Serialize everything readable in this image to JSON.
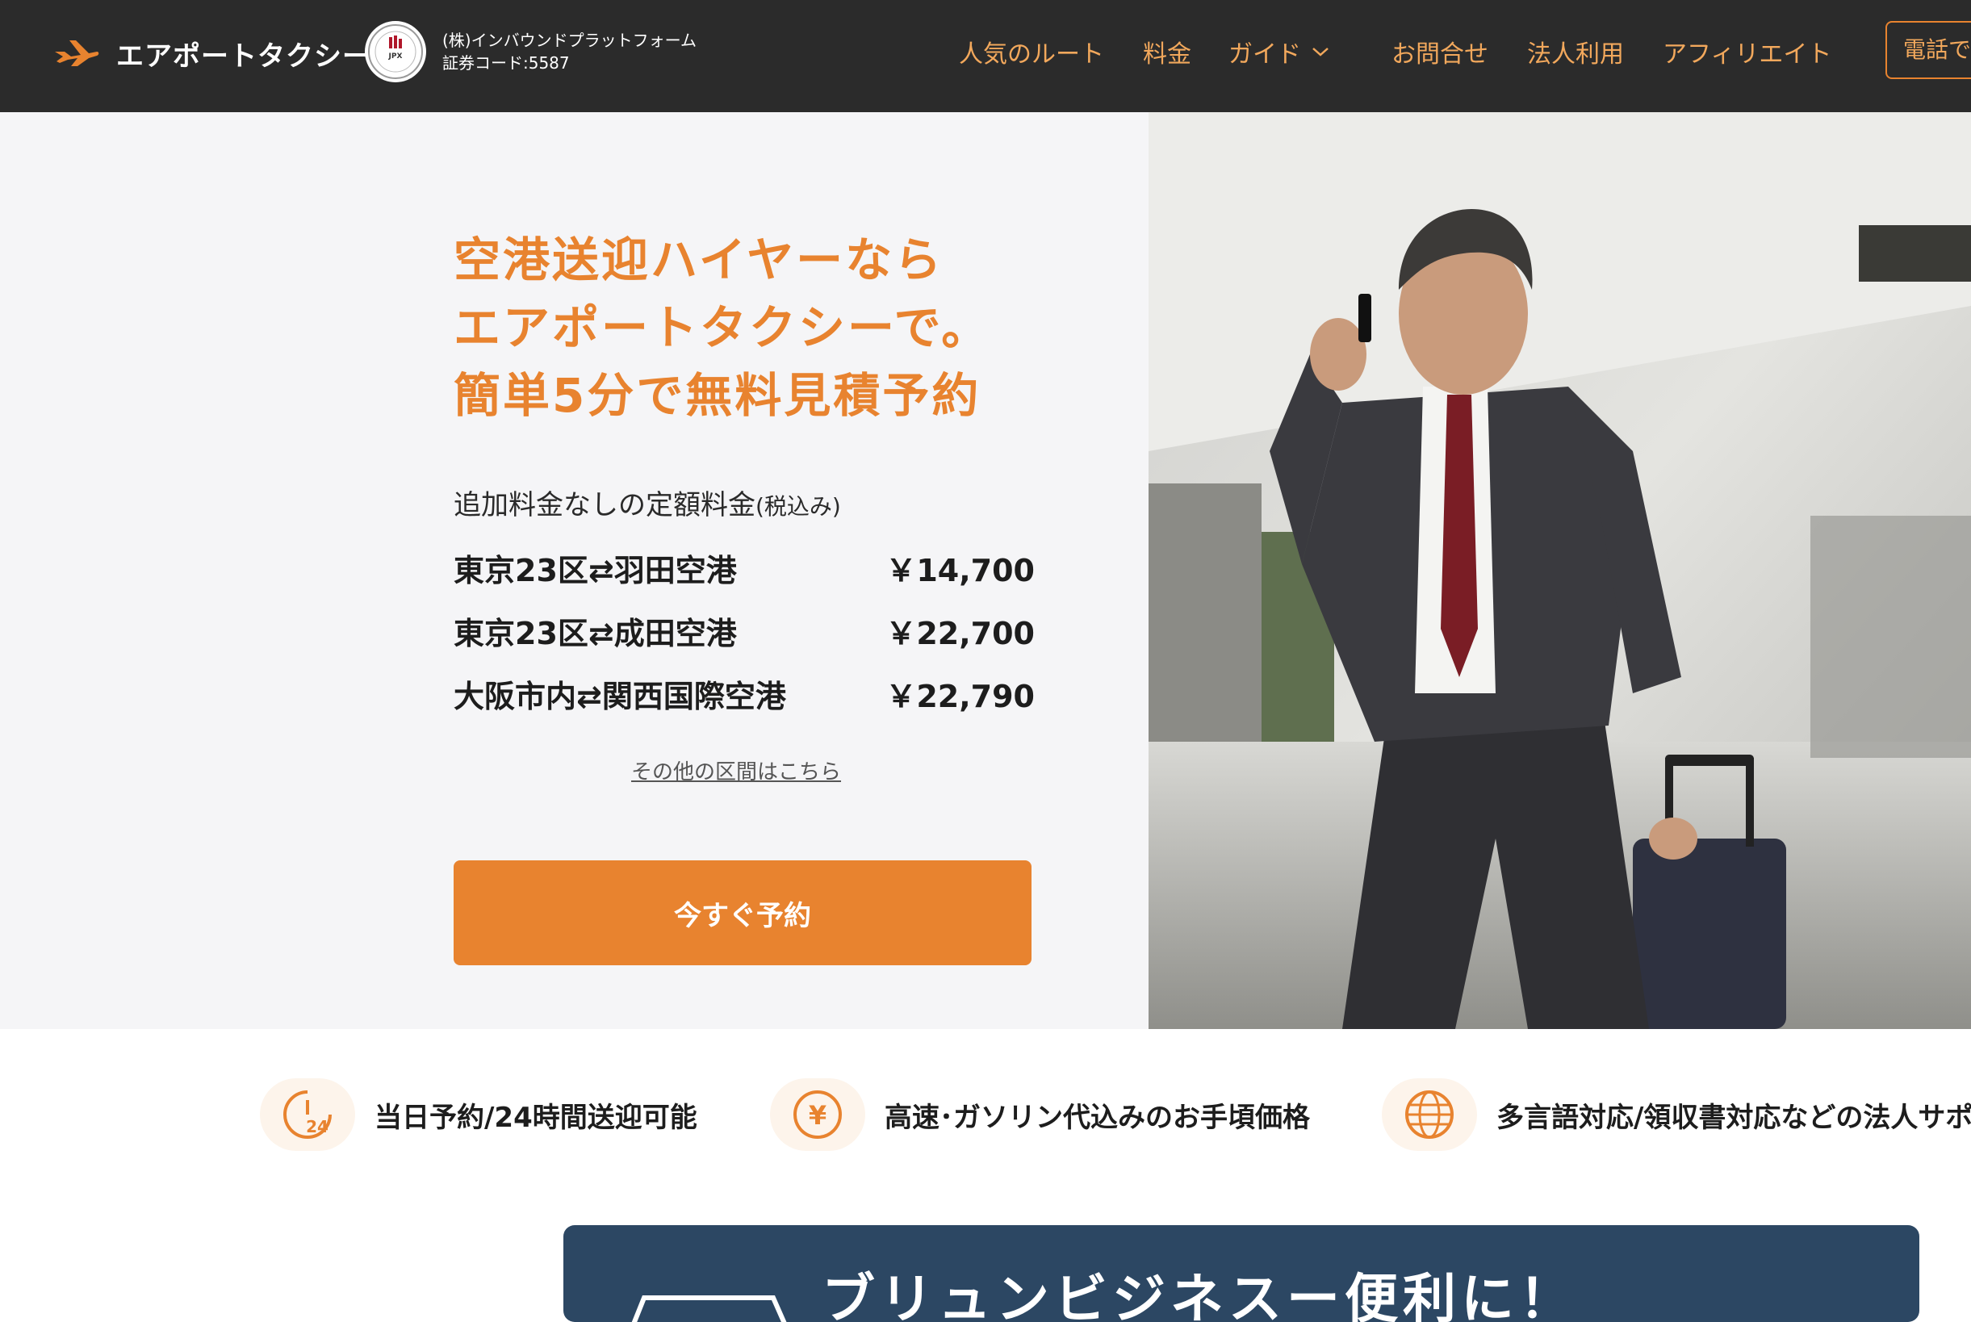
{
  "header": {
    "brand": "エアポートタクシー",
    "company": "(株)インバウンドプラットフォーム",
    "stock_code": "証券コード:5587",
    "seal_text": "JPX",
    "nav": [
      "人気のルート",
      "料金",
      "ガイド",
      "お問合せ",
      "法人利用",
      "アフィリエイト"
    ],
    "phone_label": "電話で"
  },
  "hero": {
    "headline": [
      "空港送迎ハイヤーなら",
      "エアポートタクシーで。",
      "簡単5分で無料見積予約"
    ],
    "price_intro": "追加料金なしの定額料金",
    "price_intro_tax": "(税込み)",
    "routes": [
      {
        "name": "東京23区⇄羽田空港",
        "price": "￥14,700"
      },
      {
        "name": "東京23区⇄成田空港",
        "price": "￥22,700"
      },
      {
        "name": "大阪市内⇄関西国際空港",
        "price": "￥22,790"
      }
    ],
    "other_link": "その他の区間はこちら",
    "cta": "今すぐ予約"
  },
  "features": [
    {
      "icon": "clock-24-icon",
      "text": "当日予約/24時間送迎可能"
    },
    {
      "icon": "yen-icon",
      "text": "高速･ガソリン代込みのお手頃価格"
    },
    {
      "icon": "globe-icon",
      "text": "多言語対応/領収書対応などの法人サポ"
    }
  ],
  "banner": {
    "text": "ブリュンビジネスー便利に！"
  },
  "colors": {
    "accent": "#e8832f",
    "header_bg": "#2b2b2b",
    "hero_bg": "#f5f5f7",
    "banner_bg": "#2c4763"
  }
}
